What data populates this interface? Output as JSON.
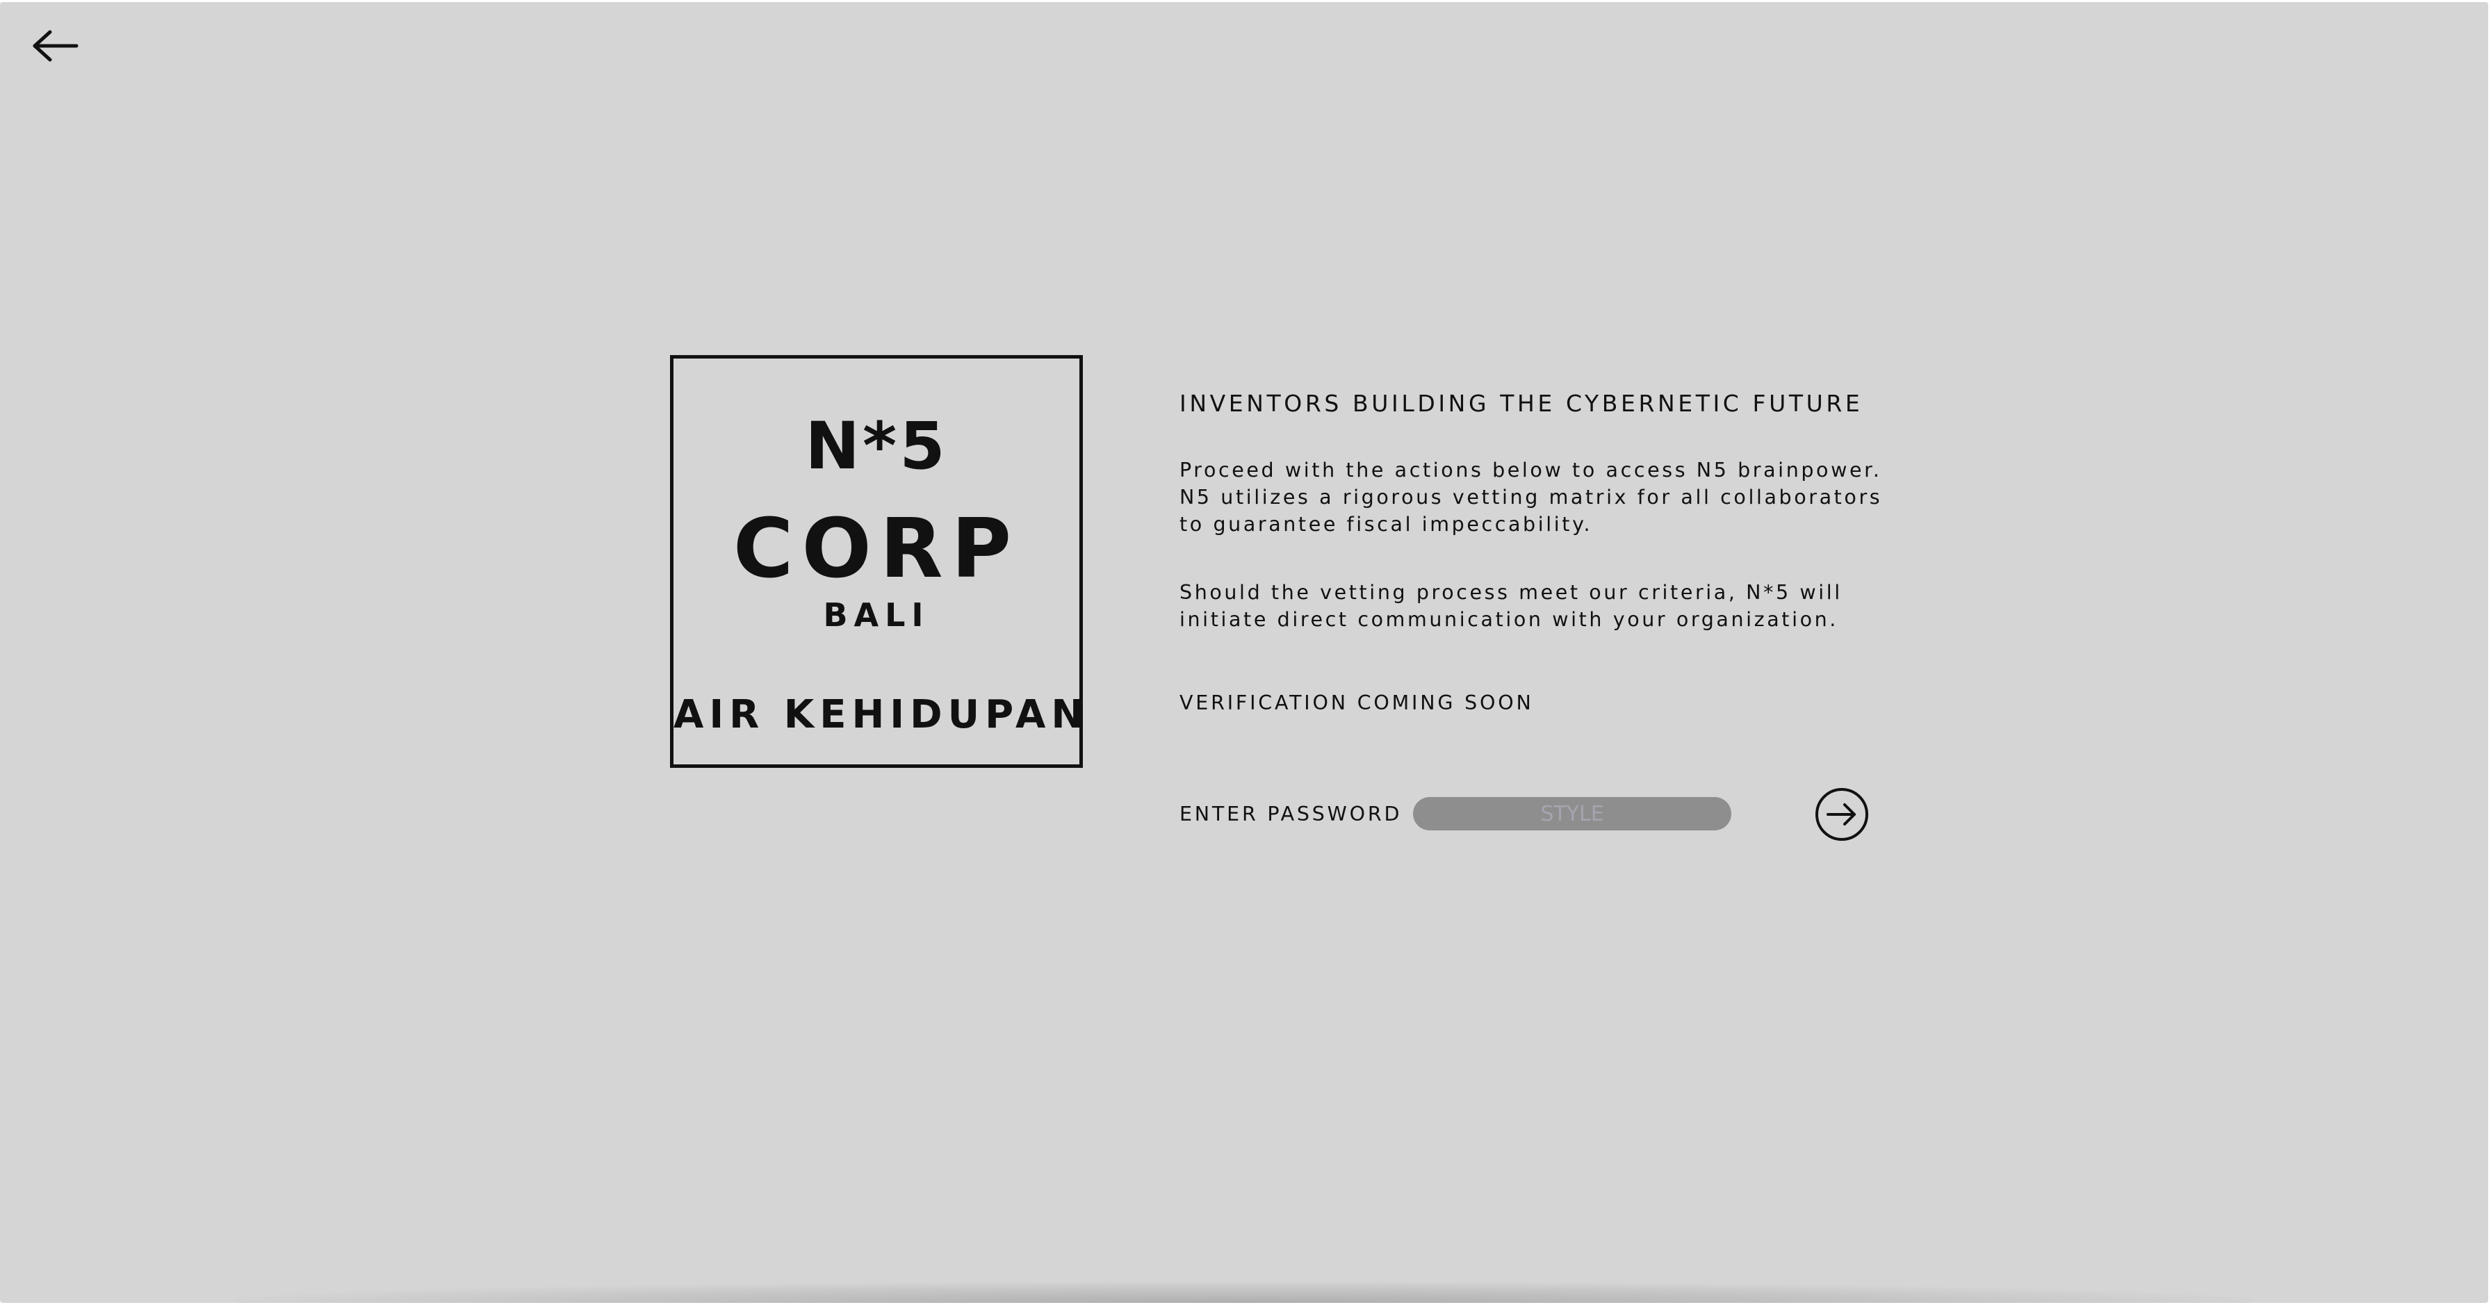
{
  "navigation": {
    "back_icon": "arrow-left-icon"
  },
  "logo": {
    "line1": "N*5",
    "line2": "CORP",
    "line3": "BALI",
    "line4": "AIR KEHIDUPAN"
  },
  "content": {
    "heading": "INVENTORS BUILDING THE CYBERNETIC FUTURE",
    "paragraph1": [
      "Proceed with the actions below to access N5 brainpower.",
      "N5 utilizes a rigorous vetting matrix for all collaborators",
      "to guarantee fiscal impeccability."
    ],
    "paragraph2": [
      "Should the vetting process meet our criteria, N*5 will",
      "initiate direct communication with your organization."
    ],
    "verification": "VERIFICATION COMING SOON"
  },
  "password": {
    "label": "ENTER PASSWORD",
    "placeholder": "STYLE",
    "value": "",
    "submit_icon": "arrow-right-circle-icon"
  },
  "colors": {
    "background": "#d5d5d5",
    "text": "#111111",
    "input_background": "#8e8e8e"
  }
}
